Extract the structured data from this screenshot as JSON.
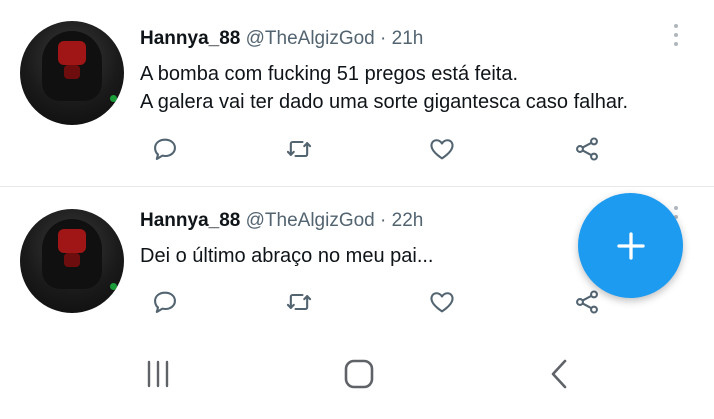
{
  "tweets": [
    {
      "name": "Hannya_88",
      "handle": "@TheAlgizGod",
      "separator": "·",
      "time": "21h",
      "lines": [
        "A bomba com fucking 51 pregos está feita.",
        "A galera vai ter dado uma sorte gigantesca caso falhar."
      ]
    },
    {
      "name": "Hannya_88",
      "handle": "@TheAlgizGod",
      "separator": "·",
      "time": "22h",
      "lines": [
        "Dei o último abraço no meu pai..."
      ]
    }
  ],
  "icons": {
    "reply": "reply-icon",
    "retweet": "retweet-icon",
    "like": "heart-icon",
    "share": "share-icon",
    "more": "more-vertical-icon",
    "compose": "plus-icon"
  },
  "colors": {
    "accent": "#1d9bf0",
    "icon": "#536471",
    "text": "#0f1419"
  }
}
